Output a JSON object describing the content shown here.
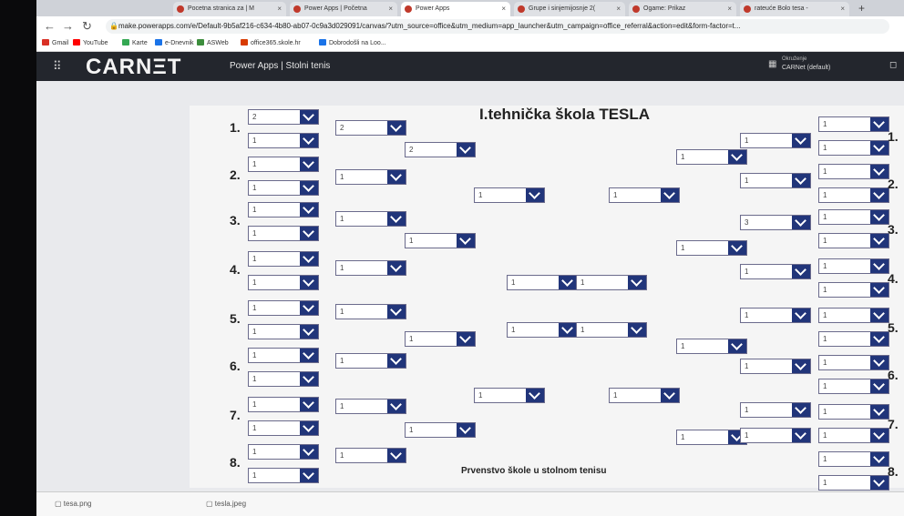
{
  "browser": {
    "tabs": [
      {
        "label": "Pocetna stranica za | M",
        "active": false
      },
      {
        "label": "Power Apps | Početna",
        "active": false
      },
      {
        "label": "Power Apps",
        "active": true
      },
      {
        "label": "Grupe i sinjemijosnje 2(",
        "active": false
      },
      {
        "label": "Ogame: Prikaz",
        "active": false
      },
      {
        "label": "rateuće Bolo tesa -",
        "active": false
      }
    ],
    "new_tab": "+",
    "url": "make.powerapps.com/e/Default-9b5af216-c634-4b80-ab07-0c9a3d029091/canvas/?utm_source=office&utm_medium=app_launcher&utm_campaign=office_referral&action=edit&form-factor=t...",
    "bookmarks": [
      {
        "label": "Gmail",
        "color": "#d93025"
      },
      {
        "label": "YouTube",
        "color": "#ff0000"
      },
      {
        "label": "Karte",
        "color": "#34a853"
      },
      {
        "label": "e-Dnevnik",
        "color": "#1a73e8"
      },
      {
        "label": "ASWeb",
        "color": "#3c8d3c"
      },
      {
        "label": "office365.skole.hr",
        "color": "#d83b01"
      },
      {
        "label": "Dobrodošli na Loo...",
        "color": "#1a73e8"
      }
    ]
  },
  "app": {
    "logo": "CARNΞT",
    "title": "Power Apps | Stolni tenis",
    "env_label": "Okruženje",
    "env_name": "CARNet (default)"
  },
  "canvas": {
    "title": "I.tehnička škola TESLA",
    "subtitle": "Prvenstvo škole u stolnom tenisu",
    "left_numbers": [
      "1.",
      "2.",
      "3.",
      "4.",
      "5.",
      "6.",
      "7.",
      "8."
    ],
    "right_numbers": [
      "1.",
      "2.",
      "3.",
      "4.",
      "5.",
      "6.",
      "7.",
      "8."
    ],
    "left_r1": [
      "2",
      "1",
      "1",
      "1",
      "1",
      "1",
      "1",
      "1",
      "1",
      "1",
      "1",
      "1",
      "1",
      "1",
      "1",
      "1"
    ],
    "left_r2": [
      "2",
      "1",
      "1",
      "1",
      "1",
      "1",
      "1",
      "1"
    ],
    "left_r3": [
      "2",
      "1",
      "1",
      "1"
    ],
    "left_r4": [
      "1",
      "1"
    ],
    "left_final": [
      "1",
      "1"
    ],
    "right_final": [
      "1",
      "1"
    ],
    "right_r4": [
      "1",
      "1"
    ],
    "right_r3": [
      "1",
      "1",
      "1",
      "1"
    ],
    "right_r2": [
      "1",
      "1",
      "3",
      "1",
      "1",
      "1",
      "1",
      "1"
    ],
    "right_r1": [
      "1",
      "1",
      "1",
      "1",
      "1",
      "1",
      "1",
      "1",
      "1",
      "1",
      "1",
      "1",
      "1",
      "1",
      "1",
      "1"
    ]
  },
  "downloads": [
    {
      "label": "tesa.png"
    },
    {
      "label": "tesla.jpeg"
    }
  ]
}
